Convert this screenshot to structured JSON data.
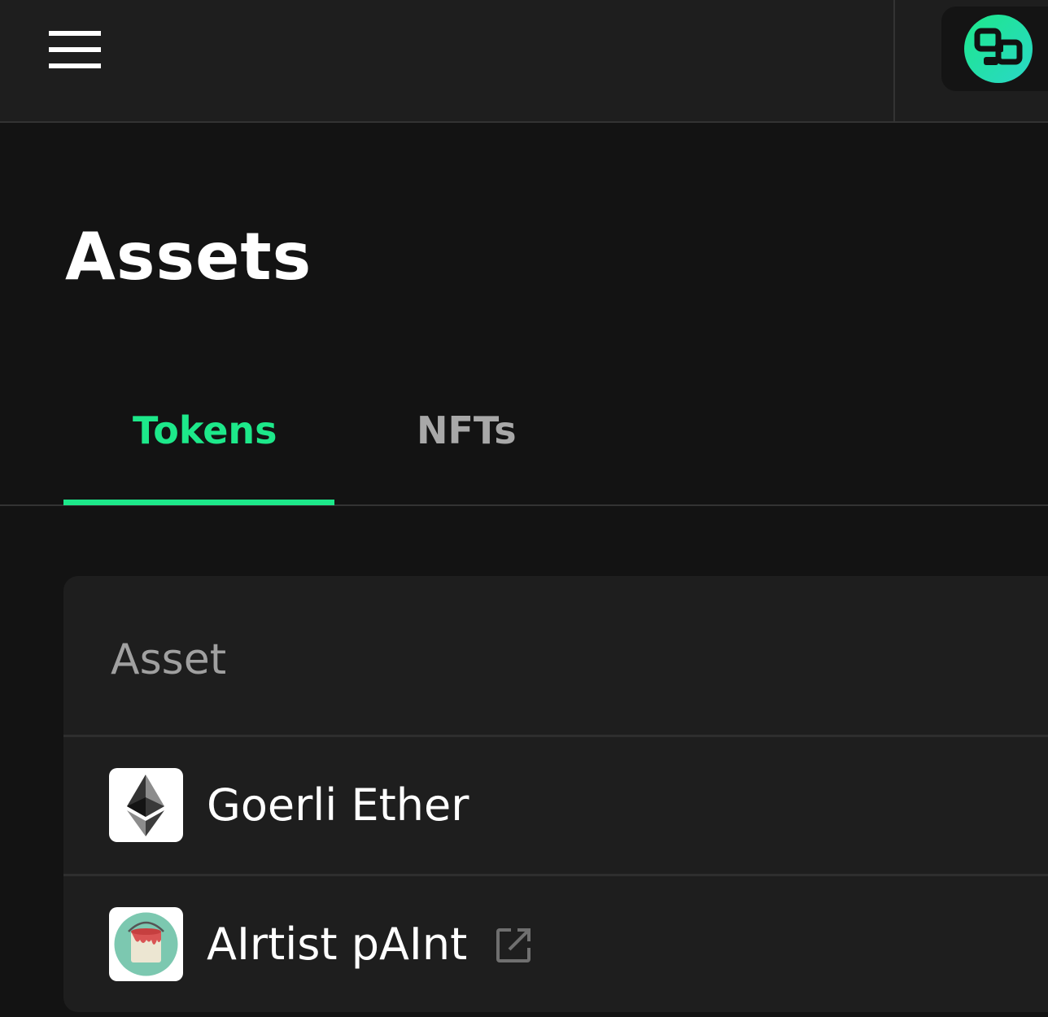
{
  "header": {
    "menu_icon": "hamburger-menu-icon",
    "logo_icon": "app-logo-icon",
    "accent_color": "#1de88a"
  },
  "page": {
    "title": "Assets"
  },
  "tabs": [
    {
      "label": "Tokens",
      "active": true
    },
    {
      "label": "NFTs",
      "active": false
    }
  ],
  "table": {
    "column_header": "Asset",
    "rows": [
      {
        "name": "Goerli Ether",
        "icon": "ethereum-icon",
        "external_link": false
      },
      {
        "name": "AIrtist pAInt",
        "icon": "paint-bucket-icon",
        "external_link": true,
        "link_icon": "external-link-icon"
      }
    ]
  }
}
